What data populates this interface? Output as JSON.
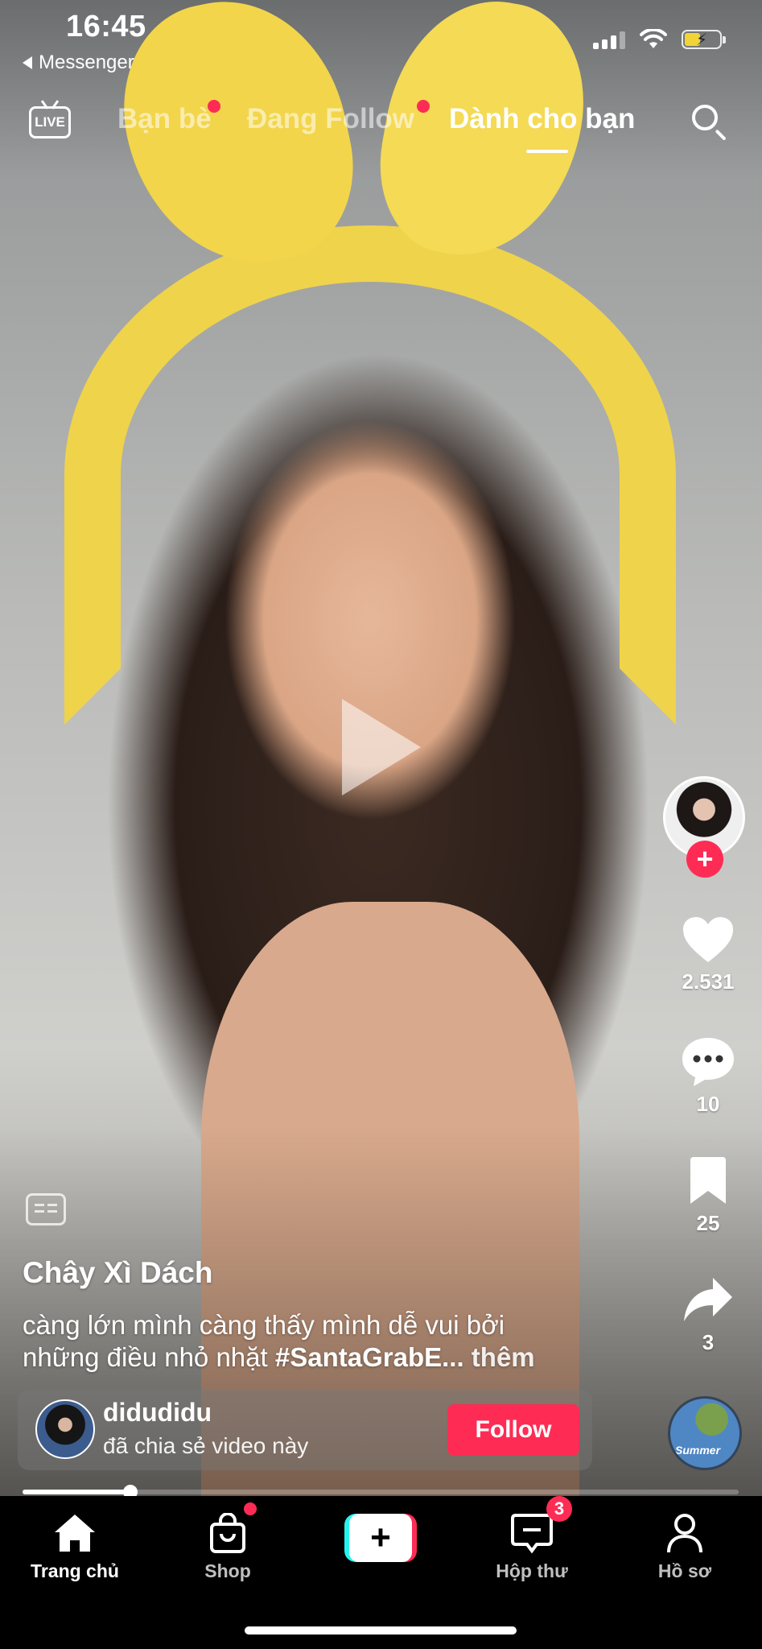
{
  "status_bar": {
    "time": "16:45",
    "back_app": "Messenger"
  },
  "top_nav": {
    "live_label": "LIVE",
    "tabs": [
      {
        "label": "Bạn bè",
        "active": false,
        "has_dot": true
      },
      {
        "label": "Đang Follow",
        "active": false,
        "has_dot": true
      },
      {
        "label": "Dành cho bạn",
        "active": true,
        "has_dot": false
      }
    ]
  },
  "player": {
    "state": "paused",
    "progress_fraction": 0.15
  },
  "right_rail": {
    "likes": "2.531",
    "comments": "10",
    "saves": "25",
    "shares": "3"
  },
  "post": {
    "author": "Chây Xì Dách",
    "description": "càng lớn mình càng thấy mình dễ vui bởi những điều nhỏ nhặt ",
    "hashtag": "#SantaGrabE...",
    "more_label": "thêm"
  },
  "share_card": {
    "username": "didudidu",
    "subtitle": "đã chia sẻ video này",
    "follow_label": "Follow"
  },
  "music": {
    "disc_text": "Summer"
  },
  "tab_bar": {
    "items": [
      {
        "label": "Trang chủ",
        "icon": "home-icon",
        "active": true
      },
      {
        "label": "Shop",
        "icon": "shopping-bag-icon",
        "badge_dot": true
      },
      {
        "label": "",
        "icon": "create-plus-icon"
      },
      {
        "label": "Hộp thư",
        "icon": "inbox-icon",
        "badge_count": "3"
      },
      {
        "label": "Hồ sơ",
        "icon": "profile-icon"
      }
    ]
  },
  "colors": {
    "accent": "#fe2c55",
    "accent_cyan": "#25f4ee"
  }
}
